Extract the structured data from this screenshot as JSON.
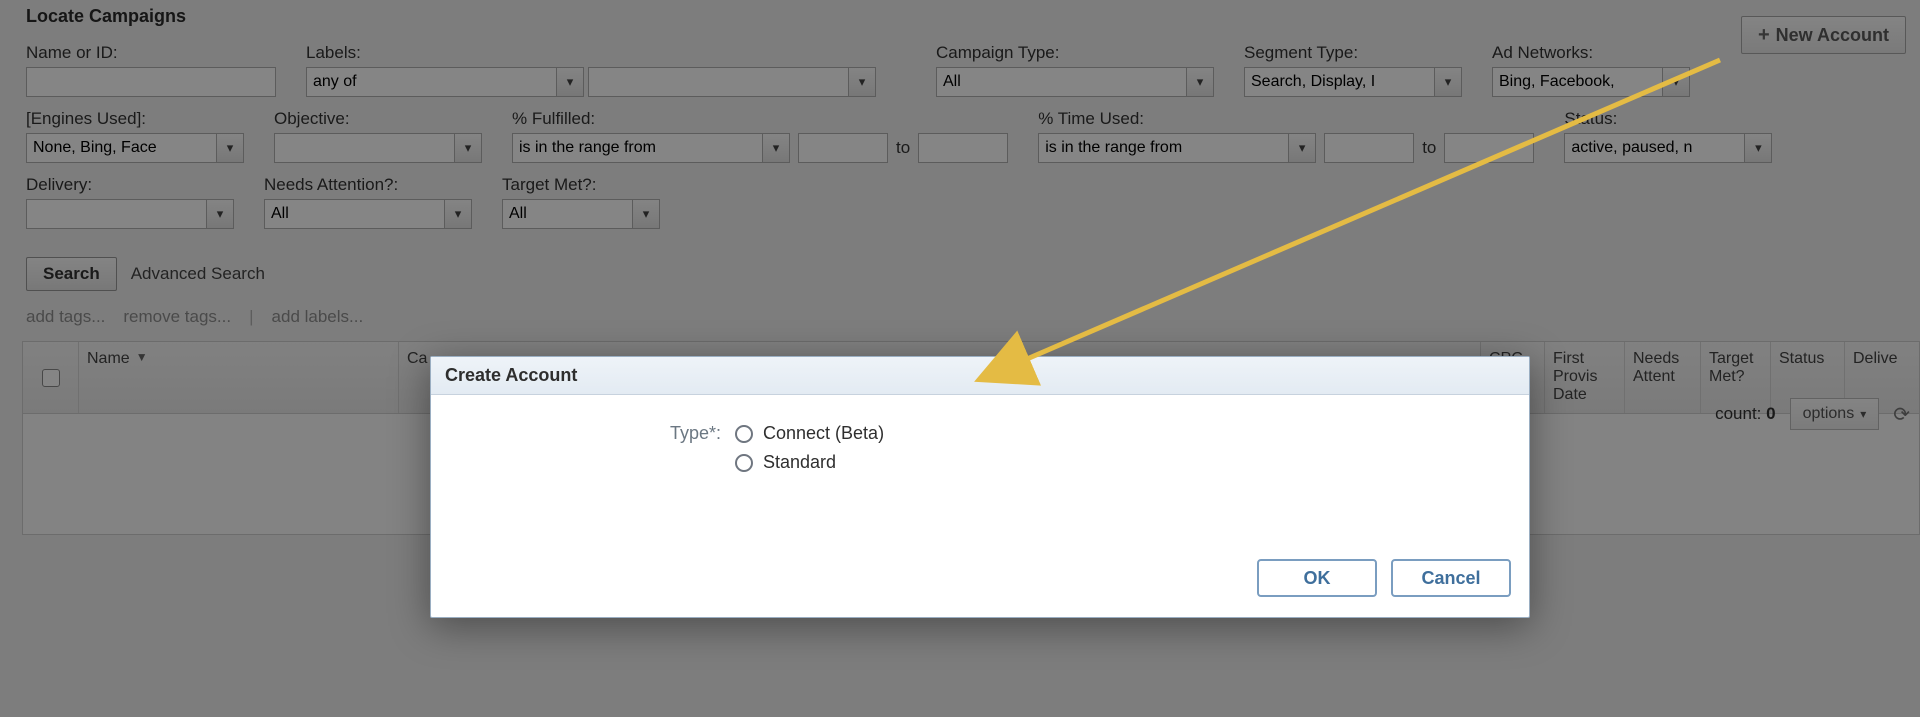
{
  "section_title": "Locate Campaigns",
  "new_account_btn": "New Account",
  "filters": {
    "name_or_id_label": "Name or ID:",
    "labels_label": "Labels:",
    "labels_combo": "any of",
    "campaign_type_label": "Campaign Type:",
    "campaign_type_value": "All",
    "segment_type_label": "Segment Type:",
    "segment_type_value": "Search, Display, I",
    "ad_networks_label": "Ad Networks:",
    "ad_networks_value": "Bing, Facebook,",
    "engines_used_label": "[Engines Used]:",
    "engines_used_value": "None, Bing, Face",
    "objective_label": "Objective:",
    "pct_fulfilled_label": "% Fulfilled:",
    "range_op": "is in the range from",
    "range_to": "to",
    "pct_time_used_label": "% Time Used:",
    "status_label": "Status:",
    "status_value": "active, paused, n",
    "delivery_label": "Delivery:",
    "needs_attention_label": "Needs Attention?:",
    "needs_attention_value": "All",
    "target_met_label": "Target Met?:",
    "target_met_value": "All"
  },
  "search_btn": "Search",
  "advanced_search": "Advanced Search",
  "tags": {
    "add_tags": "add tags...",
    "remove_tags": "remove tags...",
    "add_labels": "add labels...",
    "count_label": "count:",
    "count_value": "0",
    "options": "options"
  },
  "grid_columns": {
    "name": "Name",
    "campaign": "Ca",
    "cpc": "CPC",
    "first_provision_date": "First Provis Date",
    "needs_attention": "Needs Attent",
    "target_met": "Target Met?",
    "status": "Status",
    "delivery": "Delive"
  },
  "dialog": {
    "title": "Create Account",
    "type_label": "Type*:",
    "option1": "Connect (Beta)",
    "option2": "Standard",
    "ok": "OK",
    "cancel": "Cancel"
  },
  "colors": {
    "arrow": "#e4bb44"
  }
}
